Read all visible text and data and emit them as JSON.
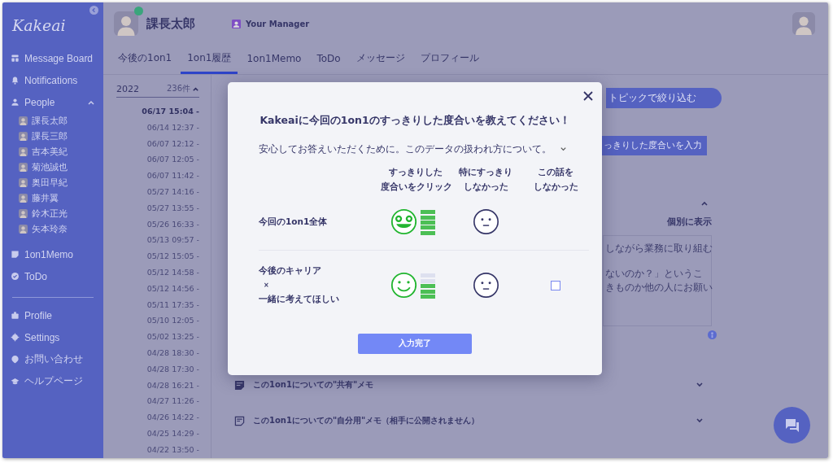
{
  "sidebar": {
    "logo": "Kakeai",
    "items": [
      {
        "label": "Message Board"
      },
      {
        "label": "Notifications"
      },
      {
        "label": "People",
        "expanded": true
      }
    ],
    "people": [
      "課長太郎",
      "課長三郎",
      "吉本美紀",
      "菊池誠也",
      "奥田早紀",
      "藤井翼",
      "鈴木正光",
      "矢本玲奈"
    ],
    "items_after": [
      {
        "label": "1on1Memo"
      },
      {
        "label": "ToDo"
      }
    ],
    "bottom_items": [
      {
        "label": "Profile"
      },
      {
        "label": "Settings"
      },
      {
        "label": "お問い合わせ"
      },
      {
        "label": "ヘルプページ"
      }
    ]
  },
  "header": {
    "name": "課長太郎",
    "online": true,
    "role": "Your Manager"
  },
  "tabs": [
    {
      "label": "今後の1on1",
      "selected": false
    },
    {
      "label": "1on1履歴",
      "selected": true
    },
    {
      "label": "1on1Memo",
      "selected": false
    },
    {
      "label": "ToDo",
      "selected": false
    },
    {
      "label": "メッセージ",
      "selected": false
    },
    {
      "label": "プロフィール",
      "selected": false
    }
  ],
  "history": {
    "year": "2022",
    "count": "236件",
    "expanded": true,
    "dates": [
      {
        "label": "06/17 15:04 -",
        "selected": true
      },
      {
        "label": "06/14 12:37 -",
        "selected": false
      },
      {
        "label": "06/07 12:12 -",
        "selected": false
      },
      {
        "label": "06/07 12:05 -",
        "selected": false
      },
      {
        "label": "06/07 11:42 -",
        "selected": false
      },
      {
        "label": "05/27 14:16 -",
        "selected": false
      },
      {
        "label": "05/27 13:55 -",
        "selected": false
      },
      {
        "label": "05/26 16:33 -",
        "selected": false
      },
      {
        "label": "05/13 09:57 -",
        "selected": false
      },
      {
        "label": "05/12 15:05 -",
        "selected": false
      },
      {
        "label": "05/12 14:58 -",
        "selected": false
      },
      {
        "label": "05/12 14:56 -",
        "selected": false
      },
      {
        "label": "05/11 17:35 -",
        "selected": false
      },
      {
        "label": "05/10 12:05 -",
        "selected": false
      },
      {
        "label": "05/02 13:25 -",
        "selected": false
      },
      {
        "label": "04/28 18:30 -",
        "selected": false
      },
      {
        "label": "04/28 17:30 -",
        "selected": false
      },
      {
        "label": "04/28 16:21 -",
        "selected": false
      },
      {
        "label": "04/27 11:26 -",
        "selected": false
      },
      {
        "label": "04/26 14:22 -",
        "selected": false
      },
      {
        "label": "04/25 14:29 -",
        "selected": false
      },
      {
        "label": "04/22 13:50 -",
        "selected": false
      }
    ]
  },
  "detail": {
    "filter_button": "トピックで絞り込む",
    "rate_button": "っきりした度合いを入力",
    "show_individually": "個別に表示",
    "memo_lines": [
      "しながら業務に取り組む",
      "ないのか？」というこ",
      "きものか他の人にお願い"
    ],
    "sections": [
      {
        "label": "この1on1についての\"共有\"メモ"
      },
      {
        "label": "この1on1についての\"自分用\"メモ（相手に公開されません）"
      }
    ]
  },
  "modal": {
    "title": "Kakeaiに今回の1on1のすっきりした度合いを教えてください！",
    "note": "安心してお答えいただくために。このデータの扱われ方について。",
    "note_expanded": false,
    "columns": [
      [
        "すっきりした",
        "度合いをクリック"
      ],
      [
        "特にすっきり",
        "しなかった"
      ],
      [
        "この話を",
        "しなかった"
      ]
    ],
    "rows": [
      {
        "lines": [
          "今回の1on1全体"
        ],
        "kind": "star_eyes",
        "level": 1.0
      },
      {
        "lines": [
          "今後のキャリア",
          "×",
          "一緒に考えてほしい"
        ],
        "kind": "smile",
        "level": 0.6,
        "checkbox": {
          "checked": false
        }
      }
    ],
    "submit": "入力完了"
  }
}
